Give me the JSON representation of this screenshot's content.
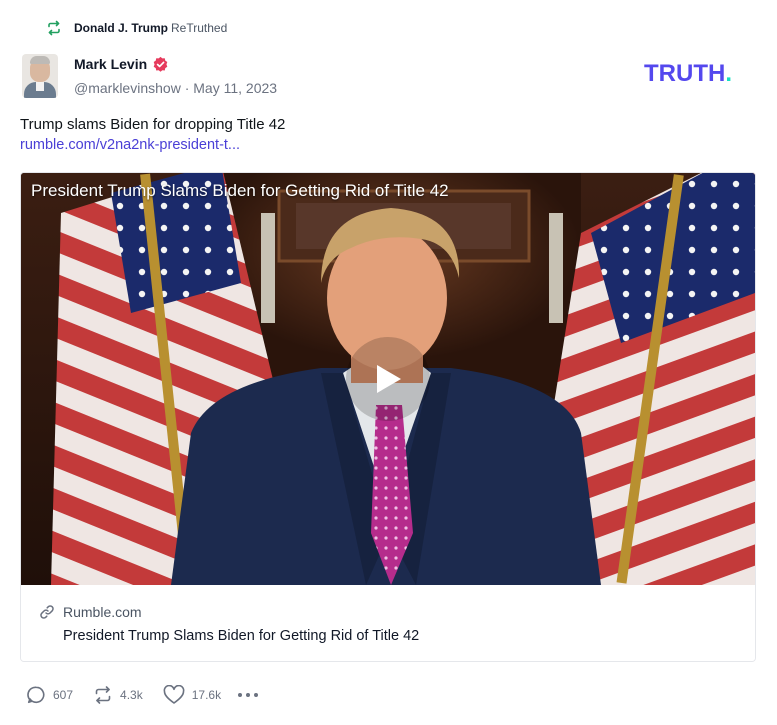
{
  "retruth": {
    "user": "Donald J. Trump",
    "action": "ReTruthed"
  },
  "author": {
    "name": "Mark Levin",
    "verified": true,
    "handle": "@marklevinshow",
    "date": "May 11, 2023"
  },
  "brand": {
    "logo_text": "TRUTH",
    "logo_dot": ".",
    "color": "#5448ee",
    "dot_color": "#17e0c1"
  },
  "post": {
    "text": "Trump slams Biden for dropping Title 42",
    "link": "rumble.com/v2na2nk-president-t..."
  },
  "card": {
    "video_title": "President Trump Slams Biden for Getting Rid of Title 42",
    "source": "Rumble.com",
    "title": "President Trump Slams Biden for Getting Rid of Title 42"
  },
  "stats": {
    "replies": "607",
    "retruths": "4.3k",
    "likes": "17.6k"
  },
  "icons": [
    "retruth-icon",
    "verified-badge-icon",
    "link-icon",
    "play-icon",
    "reply-icon",
    "like-icon",
    "more-icon"
  ]
}
